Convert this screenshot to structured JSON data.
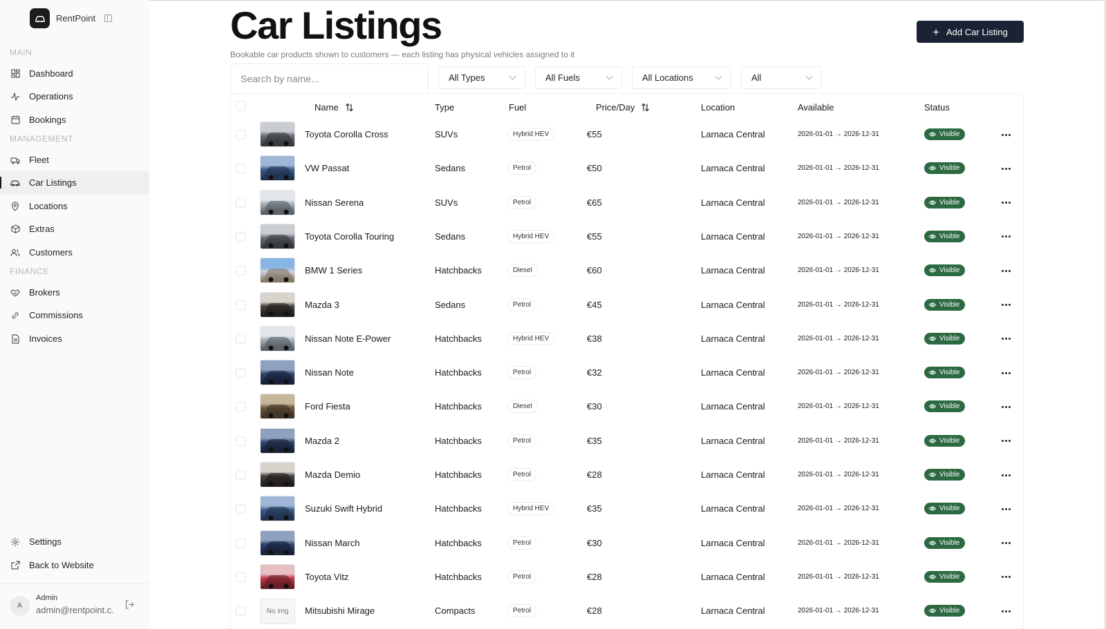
{
  "app": {
    "name": "RentPoint"
  },
  "sidebar": {
    "sections": {
      "main": "MAIN",
      "management": "MANAGEMENT",
      "finance": "FINANCE"
    },
    "items": [
      {
        "label": "Dashboard",
        "icon": "grid-icon"
      },
      {
        "label": "Operations",
        "icon": "activity-icon"
      },
      {
        "label": "Bookings",
        "icon": "calendar-icon"
      },
      {
        "label": "Fleet",
        "icon": "car-icon"
      },
      {
        "label": "Car Listings",
        "icon": "car-side-icon",
        "active": true
      },
      {
        "label": "Locations",
        "icon": "map-pin-icon"
      },
      {
        "label": "Extras",
        "icon": "box-icon"
      },
      {
        "label": "Customers",
        "icon": "users-icon"
      },
      {
        "label": "Brokers",
        "icon": "handshake-icon"
      },
      {
        "label": "Commissions",
        "icon": "link-icon"
      },
      {
        "label": "Invoices",
        "icon": "file-icon"
      },
      {
        "label": "Settings",
        "icon": "gear-icon"
      },
      {
        "label": "Back to Website",
        "icon": "external-link-icon"
      }
    ],
    "user": {
      "initial": "A",
      "name": "Admin",
      "email": "admin@rentpoint.c..."
    }
  },
  "header": {
    "title": "Car Listings",
    "subtitle": "Bookable car products shown to customers — each listing has physical vehicles assigned to it",
    "add_button": "Add Car Listing"
  },
  "filters": {
    "search_placeholder": "Search by name...",
    "type": "All Types",
    "fuel": "All Fuels",
    "location": "All Locations",
    "visibility": "All"
  },
  "table": {
    "columns": {
      "name": "Name",
      "type": "Type",
      "fuel": "Fuel",
      "price": "Price/Day",
      "location": "Location",
      "available": "Available",
      "status": "Status"
    },
    "rows": [
      {
        "name": "Toyota Corolla Cross",
        "type": "SUVs",
        "fuel": "Hybrid HEV",
        "price": "€55",
        "location": "Larnaca Central",
        "available": "2026-01-01 → 2026-12-31",
        "status": "Visible",
        "thumb": "silver"
      },
      {
        "name": "VW Passat",
        "type": "Sedans",
        "fuel": "Petrol",
        "price": "€50",
        "location": "Larnaca Central",
        "available": "2026-01-01 → 2026-12-31",
        "status": "Visible",
        "thumb": "blue"
      },
      {
        "name": "Nissan Serena",
        "type": "SUVs",
        "fuel": "Petrol",
        "price": "€65",
        "location": "Larnaca Central",
        "available": "2026-01-01 → 2026-12-31",
        "status": "Visible",
        "thumb": "white"
      },
      {
        "name": "Toyota Corolla Touring",
        "type": "Sedans",
        "fuel": "Hybrid HEV",
        "price": "€55",
        "location": "Larnaca Central",
        "available": "2026-01-01 → 2026-12-31",
        "status": "Visible",
        "thumb": "silver"
      },
      {
        "name": "BMW 1 Series",
        "type": "Hatchbacks",
        "fuel": "Diesel",
        "price": "€60",
        "location": "Larnaca Central",
        "available": "2026-01-01 → 2026-12-31",
        "status": "Visible",
        "thumb": "sky"
      },
      {
        "name": "Mazda 3",
        "type": "Sedans",
        "fuel": "Petrol",
        "price": "€45",
        "location": "Larnaca Central",
        "available": "2026-01-01 → 2026-12-31",
        "status": "Visible",
        "thumb": "dark"
      },
      {
        "name": "Nissan Note E-Power",
        "type": "Hatchbacks",
        "fuel": "Hybrid HEV",
        "price": "€38",
        "location": "Larnaca Central",
        "available": "2026-01-01 → 2026-12-31",
        "status": "Visible",
        "thumb": "white"
      },
      {
        "name": "Nissan Note",
        "type": "Hatchbacks",
        "fuel": "Petrol",
        "price": "€32",
        "location": "Larnaca Central",
        "available": "2026-01-01 → 2026-12-31",
        "status": "Visible",
        "thumb": "navy"
      },
      {
        "name": "Ford Fiesta",
        "type": "Hatchbacks",
        "fuel": "Diesel",
        "price": "€30",
        "location": "Larnaca Central",
        "available": "2026-01-01 → 2026-12-31",
        "status": "Visible",
        "thumb": "earth"
      },
      {
        "name": "Mazda 2",
        "type": "Hatchbacks",
        "fuel": "Petrol",
        "price": "€35",
        "location": "Larnaca Central",
        "available": "2026-01-01 → 2026-12-31",
        "status": "Visible",
        "thumb": "navy"
      },
      {
        "name": "Mazda Demio",
        "type": "Hatchbacks",
        "fuel": "Petrol",
        "price": "€28",
        "location": "Larnaca Central",
        "available": "2026-01-01 → 2026-12-31",
        "status": "Visible",
        "thumb": "dark"
      },
      {
        "name": "Suzuki Swift Hybrid",
        "type": "Hatchbacks",
        "fuel": "Hybrid HEV",
        "price": "€35",
        "location": "Larnaca Central",
        "available": "2026-01-01 → 2026-12-31",
        "status": "Visible",
        "thumb": "blue"
      },
      {
        "name": "Nissan March",
        "type": "Hatchbacks",
        "fuel": "Petrol",
        "price": "€30",
        "location": "Larnaca Central",
        "available": "2026-01-01 → 2026-12-31",
        "status": "Visible",
        "thumb": "navy"
      },
      {
        "name": "Toyota Vitz",
        "type": "Hatchbacks",
        "fuel": "Petrol",
        "price": "€28",
        "location": "Larnaca Central",
        "available": "2026-01-01 → 2026-12-31",
        "status": "Visible",
        "thumb": "red"
      },
      {
        "name": "Mitsubishi Mirage",
        "type": "Compacts",
        "fuel": "Petrol",
        "price": "€28",
        "location": "Larnaca Central",
        "available": "2026-01-01 → 2026-12-31",
        "status": "Visible",
        "thumb": "none",
        "thumb_label": "No img"
      }
    ]
  },
  "colors": {
    "primary_button": "#1a2233",
    "status_visible": "#2c6a42",
    "sidebar_bg": "#fafafa"
  }
}
